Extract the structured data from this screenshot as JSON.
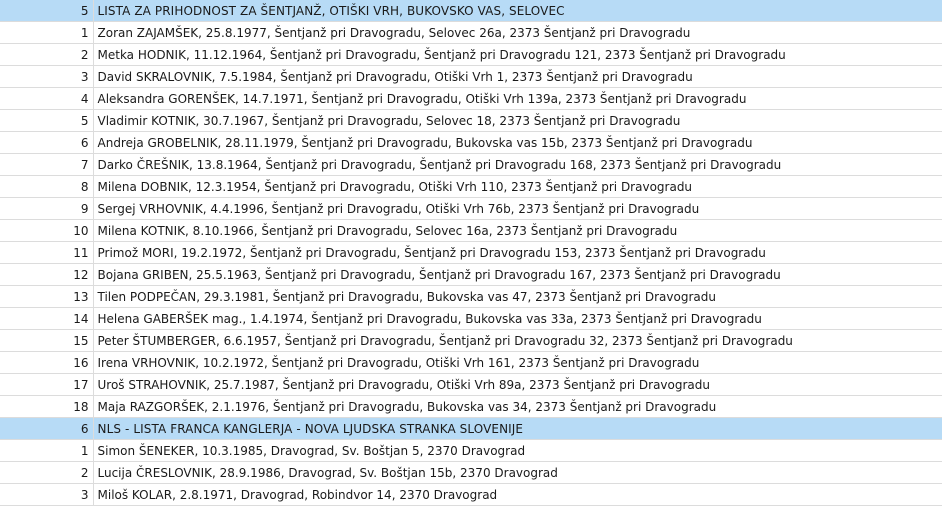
{
  "lists": [
    {
      "number": "5",
      "name": "LISTA ZA PRIHODNOST ZA ŠENTJANŽ, OTIŠKI VRH, BUKOVSKO VAS, SELOVEC",
      "candidates": [
        {
          "number": "1",
          "text": "Zoran ZAJAMŠEK, 25.8.1977, Šentjanž pri Dravogradu, Selovec 26a, 2373 Šentjanž pri Dravogradu"
        },
        {
          "number": "2",
          "text": "Metka HODNIK, 11.12.1964, Šentjanž pri Dravogradu, Šentjanž pri Dravogradu 121, 2373 Šentjanž pri Dravogradu"
        },
        {
          "number": "3",
          "text": "David SKRALOVNIK, 7.5.1984, Šentjanž pri Dravogradu, Otiški Vrh 1, 2373 Šentjanž pri Dravogradu"
        },
        {
          "number": "4",
          "text": "Aleksandra GORENŠEK, 14.7.1971, Šentjanž pri Dravogradu, Otiški Vrh 139a, 2373 Šentjanž pri Dravogradu"
        },
        {
          "number": "5",
          "text": "Vladimir KOTNIK, 30.7.1967, Šentjanž pri Dravogradu, Selovec 18, 2373 Šentjanž pri Dravogradu"
        },
        {
          "number": "6",
          "text": "Andreja GROBELNIK, 28.11.1979, Šentjanž pri Dravogradu, Bukovska vas 15b, 2373 Šentjanž pri Dravogradu"
        },
        {
          "number": "7",
          "text": "Darko ČREŠNIK, 13.8.1964, Šentjanž pri Dravogradu, Šentjanž pri Dravogradu 168, 2373 Šentjanž pri Dravogradu"
        },
        {
          "number": "8",
          "text": "Milena DOBNIK, 12.3.1954, Šentjanž pri Dravogradu, Otiški Vrh 110, 2373 Šentjanž pri Dravogradu"
        },
        {
          "number": "9",
          "text": "Sergej VRHOVNIK, 4.4.1996, Šentjanž pri Dravogradu, Otiški Vrh 76b, 2373 Šentjanž pri Dravogradu"
        },
        {
          "number": "10",
          "text": "Milena KOTNIK, 8.10.1966, Šentjanž pri Dravogradu, Selovec 16a, 2373 Šentjanž pri Dravogradu"
        },
        {
          "number": "11",
          "text": "Primož MORI, 19.2.1972, Šentjanž pri Dravogradu, Šentjanž pri Dravogradu 153, 2373 Šentjanž pri Dravogradu"
        },
        {
          "number": "12",
          "text": "Bojana GRIBEN, 25.5.1963, Šentjanž pri Dravogradu, Šentjanž pri Dravogradu 167, 2373 Šentjanž pri Dravogradu"
        },
        {
          "number": "13",
          "text": "Tilen PODPEČAN, 29.3.1981, Šentjanž pri Dravogradu, Bukovska vas 47, 2373 Šentjanž pri Dravogradu"
        },
        {
          "number": "14",
          "text": "Helena GABERŠEK mag., 1.4.1974, Šentjanž pri Dravogradu, Bukovska vas 33a, 2373 Šentjanž pri Dravogradu"
        },
        {
          "number": "15",
          "text": "Peter ŠTUMBERGER, 6.6.1957, Šentjanž pri Dravogradu, Šentjanž pri Dravogradu 32, 2373 Šentjanž pri Dravogradu"
        },
        {
          "number": "16",
          "text": "Irena VRHOVNIK, 10.2.1972, Šentjanž pri Dravogradu, Otiški Vrh 161, 2373 Šentjanž pri Dravogradu"
        },
        {
          "number": "17",
          "text": "Uroš STRAHOVNIK, 25.7.1987, Šentjanž pri Dravogradu, Otiški Vrh 89a, 2373 Šentjanž pri Dravogradu"
        },
        {
          "number": "18",
          "text": "Maja RAZGORŠEK, 2.1.1976, Šentjanž pri Dravogradu, Bukovska vas 34, 2373 Šentjanž pri Dravogradu"
        }
      ]
    },
    {
      "number": "6",
      "name": "NLS - LISTA FRANCA KANGLERJA - NOVA LJUDSKA STRANKA SLOVENIJE",
      "candidates": [
        {
          "number": "1",
          "text": "Simon ŠENEKER, 10.3.1985, Dravograd, Sv. Boštjan 5, 2370 Dravograd"
        },
        {
          "number": "2",
          "text": "Lucija ČRESLOVNIK, 28.9.1986, Dravograd, Sv. Boštjan 15b, 2370 Dravograd"
        },
        {
          "number": "3",
          "text": "Miloš KOLAR, 2.8.1971, Dravograd, Robindvor 14, 2370 Dravograd"
        }
      ]
    }
  ],
  "colors": {
    "header_row_bg": "#b7dbf6",
    "grid_line": "#dcdcdc",
    "text": "#1a1a1a"
  }
}
